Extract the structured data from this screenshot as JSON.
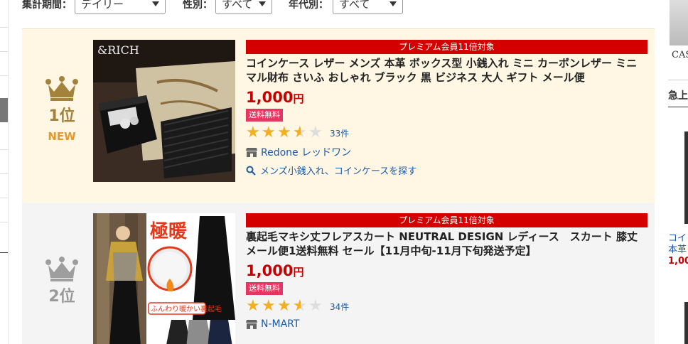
{
  "filters": {
    "period_label": "集計期間：",
    "period_value": "デイリー",
    "gender_label": "性別：",
    "gender_value": "すべて",
    "age_label": "年代別：",
    "age_value": "すべて"
  },
  "ranking": [
    {
      "rank_label": "1位",
      "new_label": "NEW",
      "premium": "プレミアム会員11倍対象",
      "title": "コインケース レザー メンズ 本革 ボックス型 小銭入れ ミニ カーボンレザー ミニマル財布 さいふ おしゃれ ブラック 黒 ビジネス 大人 ギフト メール便",
      "price": "1,000",
      "yen": "円",
      "shipping": "送料無料",
      "rating": 3.5,
      "review_count": "33件",
      "shop": "Redone レッドワン",
      "search_link": "メンズ小銭入れ、コインケースを探す",
      "image_brand": "&RICH"
    },
    {
      "rank_label": "2位",
      "premium": "プレミアム会員11倍対象",
      "title": "裏起毛マキシ丈フレアスカート NEUTRAL DESIGN レディース　スカート 膝丈 メール便1送料無料 セール【11月中旬-11月下旬発送予定】",
      "price": "1,000",
      "yen": "円",
      "shipping": "送料無料",
      "rating": 3.5,
      "review_count": "34件",
      "shop": "N-MART",
      "image_text_big": "極暖",
      "image_text_small": "ふんわり暖かい裏起毛"
    }
  ],
  "right_panel": {
    "brand": "CASI",
    "heading": "急上",
    "link_1": "コイ",
    "link_2": "本革",
    "price": "1,00"
  },
  "colors": {
    "accent_red": "#d40000",
    "price_red": "#c60000",
    "shipping_pink": "#e73562",
    "gold": "#a3823b",
    "silver": "#999999",
    "link_blue": "#1a5aa8",
    "star": "#f0b022"
  }
}
